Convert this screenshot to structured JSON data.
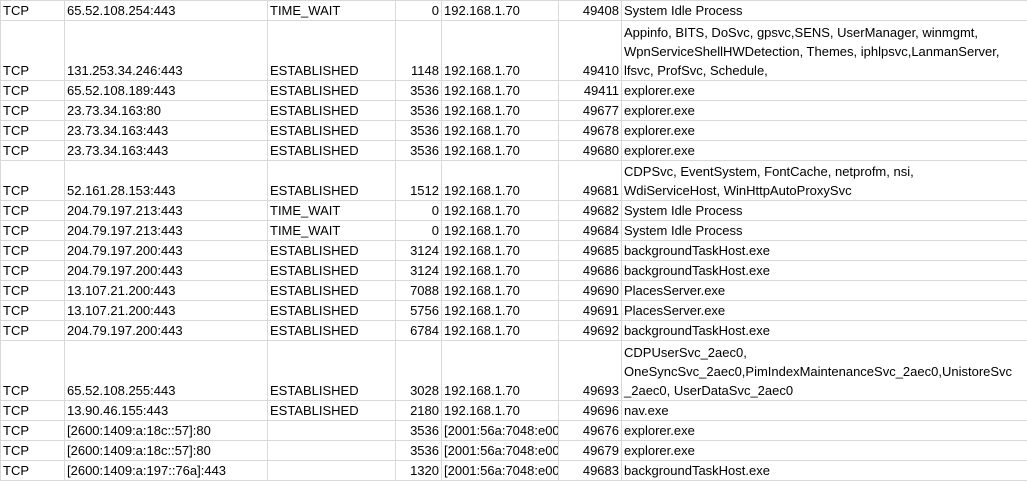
{
  "rows": [
    {
      "proto": "TCP",
      "remote": "65.52.108.254:443",
      "state": "TIME_WAIT",
      "pid": "0",
      "local_addr": "192.168.1.70",
      "local_port": "49408",
      "process_lines": [
        "System Idle Process"
      ]
    },
    {
      "proto": "TCP",
      "remote": "131.253.34.246:443",
      "state": "ESTABLISHED",
      "pid": "1148",
      "local_addr": "192.168.1.70",
      "local_port": "49410",
      "process_lines": [
        "Appinfo, BITS, DoSvc, gpsvc,SENS, UserManager, winmgmt,",
        "WpnServiceShellHWDetection, Themes, iphlpsvc,LanmanServer,",
        "lfsvc, ProfSvc, Schedule,"
      ]
    },
    {
      "proto": "TCP",
      "remote": "65.52.108.189:443",
      "state": "ESTABLISHED",
      "pid": "3536",
      "local_addr": "192.168.1.70",
      "local_port": "49411",
      "process_lines": [
        "explorer.exe"
      ]
    },
    {
      "proto": "TCP",
      "remote": "23.73.34.163:80",
      "state": "ESTABLISHED",
      "pid": "3536",
      "local_addr": "192.168.1.70",
      "local_port": "49677",
      "process_lines": [
        "explorer.exe"
      ]
    },
    {
      "proto": "TCP",
      "remote": "23.73.34.163:443",
      "state": "ESTABLISHED",
      "pid": "3536",
      "local_addr": "192.168.1.70",
      "local_port": "49678",
      "process_lines": [
        "explorer.exe"
      ]
    },
    {
      "proto": "TCP",
      "remote": "23.73.34.163:443",
      "state": "ESTABLISHED",
      "pid": "3536",
      "local_addr": "192.168.1.70",
      "local_port": "49680",
      "process_lines": [
        "explorer.exe"
      ]
    },
    {
      "proto": "TCP",
      "remote": "52.161.28.153:443",
      "state": "ESTABLISHED",
      "pid": "1512",
      "local_addr": "192.168.1.70",
      "local_port": "49681",
      "process_lines": [
        "CDPSvc, EventSystem, FontCache, netprofm, nsi,",
        "WdiServiceHost, WinHttpAutoProxySvc"
      ]
    },
    {
      "proto": "TCP",
      "remote": "204.79.197.213:443",
      "state": "TIME_WAIT",
      "pid": "0",
      "local_addr": "192.168.1.70",
      "local_port": "49682",
      "process_lines": [
        "System Idle Process"
      ]
    },
    {
      "proto": "TCP",
      "remote": "204.79.197.213:443",
      "state": "TIME_WAIT",
      "pid": "0",
      "local_addr": "192.168.1.70",
      "local_port": "49684",
      "process_lines": [
        "System Idle Process"
      ]
    },
    {
      "proto": "TCP",
      "remote": "204.79.197.200:443",
      "state": "ESTABLISHED",
      "pid": "3124",
      "local_addr": "192.168.1.70",
      "local_port": "49685",
      "process_lines": [
        "backgroundTaskHost.exe"
      ]
    },
    {
      "proto": "TCP",
      "remote": "204.79.197.200:443",
      "state": "ESTABLISHED",
      "pid": "3124",
      "local_addr": "192.168.1.70",
      "local_port": "49686",
      "process_lines": [
        "backgroundTaskHost.exe"
      ]
    },
    {
      "proto": "TCP",
      "remote": "13.107.21.200:443",
      "state": "ESTABLISHED",
      "pid": "7088",
      "local_addr": "192.168.1.70",
      "local_port": "49690",
      "process_lines": [
        "PlacesServer.exe"
      ]
    },
    {
      "proto": "TCP",
      "remote": "13.107.21.200:443",
      "state": "ESTABLISHED",
      "pid": "5756",
      "local_addr": "192.168.1.70",
      "local_port": "49691",
      "process_lines": [
        "PlacesServer.exe"
      ]
    },
    {
      "proto": "TCP",
      "remote": "204.79.197.200:443",
      "state": "ESTABLISHED",
      "pid": "6784",
      "local_addr": "192.168.1.70",
      "local_port": "49692",
      "process_lines": [
        "backgroundTaskHost.exe"
      ]
    },
    {
      "proto": "TCP",
      "remote": "65.52.108.255:443",
      "state": "ESTABLISHED",
      "pid": "3028",
      "local_addr": "192.168.1.70",
      "local_port": "49693",
      "process_lines": [
        "CDPUserSvc_2aec0,",
        "OneSyncSvc_2aec0,PimIndexMaintenanceSvc_2aec0,UnistoreSvc",
        "_2aec0, UserDataSvc_2aec0"
      ]
    },
    {
      "proto": "TCP",
      "remote": "13.90.46.155:443",
      "state": "ESTABLISHED",
      "pid": "2180",
      "local_addr": "192.168.1.70",
      "local_port": "49696",
      "process_lines": [
        "nav.exe"
      ]
    },
    {
      "proto": "TCP",
      "remote": "[2600:1409:a:18c::57]:80",
      "state": "",
      "pid": "3536",
      "local_addr": "[2001:56a:7048:e00",
      "local_port": "49676",
      "process_lines": [
        "explorer.exe"
      ]
    },
    {
      "proto": "TCP",
      "remote": "[2600:1409:a:18c::57]:80",
      "state": "",
      "pid": "3536",
      "local_addr": "[2001:56a:7048:e00",
      "local_port": "49679",
      "process_lines": [
        "explorer.exe"
      ]
    },
    {
      "proto": "TCP",
      "remote": "[2600:1409:a:197::76a]:443",
      "state": "",
      "pid": "1320",
      "local_addr": "[2001:56a:7048:e00",
      "local_port": "49683",
      "process_lines": [
        "backgroundTaskHost.exe"
      ]
    }
  ]
}
